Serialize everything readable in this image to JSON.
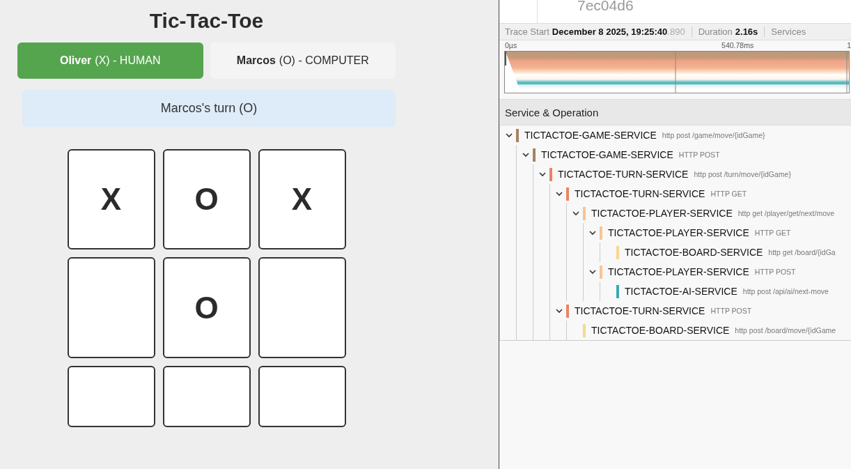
{
  "game": {
    "title": "Tic-Tac-Toe",
    "players": [
      {
        "name": "Oliver",
        "symbol": "(X) - HUMAN",
        "selected": true
      },
      {
        "name": "Marcos",
        "symbol": "(O) - COMPUTER",
        "selected": false
      }
    ],
    "turn": "Marcos's turn (O)",
    "board": [
      [
        {
          "kind": "filled",
          "mark": "X"
        },
        {
          "kind": "filled",
          "mark": "O"
        },
        {
          "kind": "filled",
          "mark": "X"
        }
      ],
      [
        {
          "kind": "empty"
        },
        {
          "kind": "filled",
          "mark": "O"
        },
        {
          "kind": "empty"
        }
      ],
      [
        {
          "kind": "empty"
        },
        {
          "kind": "empty"
        },
        {
          "kind": "empty"
        }
      ]
    ]
  },
  "trace": {
    "trace_id": "7ec04d6",
    "summary": [
      {
        "label": "Trace Start",
        "value": "December 8 2025, 19:25:40",
        "value_dim": ".890"
      },
      {
        "label": "Duration",
        "value": "2.16s"
      },
      {
        "label": "Services"
      }
    ],
    "ticks": [
      "0µs",
      "540.78ms",
      "1"
    ],
    "tree_header": "Service & Operation",
    "spans": [
      {
        "service": "TICTACTOE-GAME-SERVICE",
        "operation": "http post /game/move/{idGame}",
        "color": "#a9825f",
        "expanded": true,
        "children": [
          {
            "service": "TICTACTOE-GAME-SERVICE",
            "operation": "HTTP POST",
            "color": "#a9825f",
            "expanded": true,
            "children": [
              {
                "service": "TICTACTOE-TURN-SERVICE",
                "operation": "http post /turn/move/{idGame}",
                "color": "#ea8466",
                "expanded": true,
                "children": [
                  {
                    "service": "TICTACTOE-TURN-SERVICE",
                    "operation": "HTTP GET",
                    "color": "#ea8466",
                    "expanded": true,
                    "children": [
                      {
                        "service": "TICTACTOE-PLAYER-SERVICE",
                        "operation": "http get /player/get/next/move",
                        "color": "#f7c592",
                        "expanded": true,
                        "children": [
                          {
                            "service": "TICTACTOE-PLAYER-SERVICE",
                            "operation": "HTTP GET",
                            "color": "#f7c592",
                            "expanded": true,
                            "children": [
                              {
                                "service": "TICTACTOE-BOARD-SERVICE",
                                "operation": "http get /board/{idGa",
                                "color": "#f5d891"
                              }
                            ]
                          },
                          {
                            "service": "TICTACTOE-PLAYER-SERVICE",
                            "operation": "HTTP POST",
                            "color": "#f7c592",
                            "expanded": true,
                            "children": [
                              {
                                "service": "TICTACTOE-AI-SERVICE",
                                "operation": "http post /api/ai/next-move",
                                "color": "#3aa9b0"
                              }
                            ]
                          }
                        ]
                      }
                    ]
                  },
                  {
                    "service": "TICTACTOE-TURN-SERVICE",
                    "operation": "HTTP POST",
                    "color": "#ea8466",
                    "expanded": true,
                    "children": [
                      {
                        "service": "TICTACTOE-BOARD-SERVICE",
                        "operation": "http post /board/move/{idGame",
                        "color": "#f5d891"
                      }
                    ]
                  }
                ]
              }
            ]
          }
        ]
      }
    ]
  }
}
